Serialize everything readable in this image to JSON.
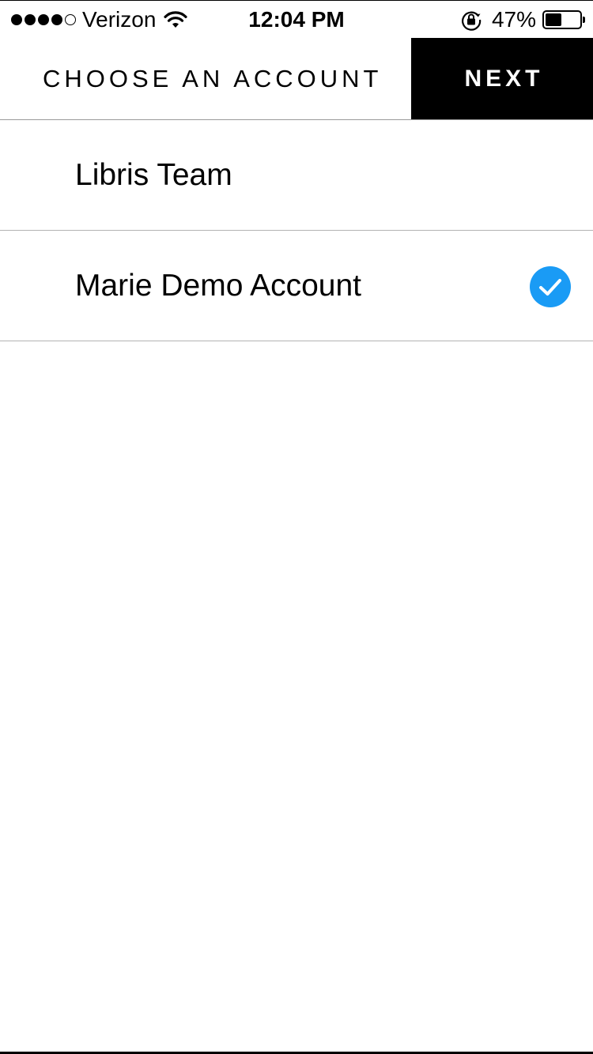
{
  "status_bar": {
    "carrier": "Verizon",
    "signal_bars_filled": 4,
    "signal_bars_total": 5,
    "time": "12:04 PM",
    "battery_percent": "47%",
    "battery_level": 0.47,
    "icons": [
      "signal-dots-icon",
      "wifi-icon",
      "rotation-lock-icon",
      "battery-icon"
    ]
  },
  "header": {
    "title": "CHOOSE AN ACCOUNT",
    "next_label": "NEXT"
  },
  "accounts": [
    {
      "name": "Libris Team",
      "selected": false
    },
    {
      "name": "Marie Demo Account",
      "selected": true
    }
  ],
  "colors": {
    "accent": "#1a9bf5",
    "header_button_bg": "#000000",
    "header_button_text": "#ffffff",
    "divider": "#b3b3b3"
  }
}
